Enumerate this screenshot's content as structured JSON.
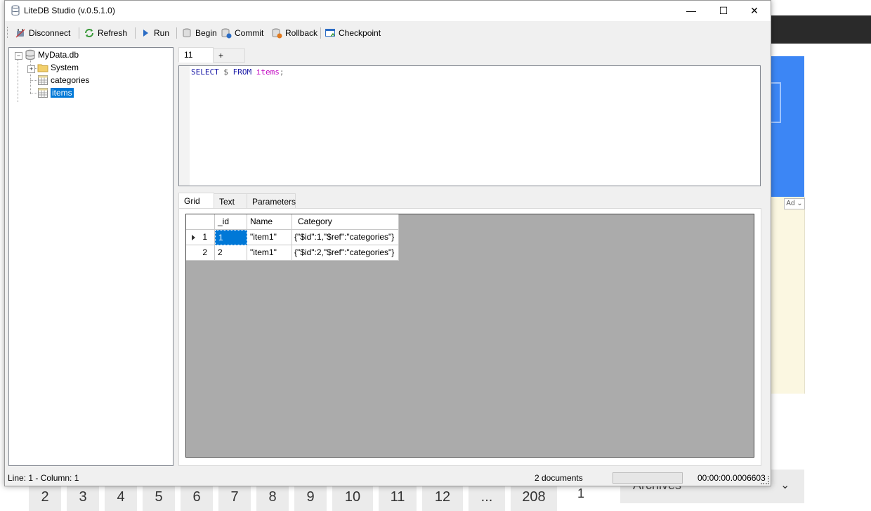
{
  "window": {
    "title": "LiteDB Studio (v.0.5.1.0)",
    "minimize_glyph": "—",
    "maximize_glyph": "☐",
    "close_glyph": "✕"
  },
  "toolbar": {
    "disconnect": "Disconnect",
    "refresh": "Refresh",
    "run": "Run",
    "begin": "Begin",
    "commit": "Commit",
    "rollback": "Rollback",
    "checkpoint": "Checkpoint"
  },
  "tree": {
    "root": "MyData.db",
    "system": "System",
    "collections": [
      "categories",
      "items"
    ],
    "selected": "items"
  },
  "query_tabs": [
    "11",
    "+"
  ],
  "editor": {
    "tokens": {
      "select": "SELECT",
      "star": "$",
      "from": "FROM",
      "table": "items",
      "semi": ";"
    }
  },
  "result_tabs": [
    "Grid",
    "Text",
    "Parameters"
  ],
  "grid": {
    "columns": [
      "_id",
      "Name",
      "Category"
    ],
    "rows": [
      {
        "index": "1",
        "cells": [
          "1",
          "\"item1\"",
          "{\"$id\":1,\"$ref\":\"categories\"}"
        ]
      },
      {
        "index": "2",
        "cells": [
          "2",
          "\"item1\"",
          "{\"$id\":2,\"$ref\":\"categories\"}"
        ]
      }
    ]
  },
  "status": {
    "position": "Line: 1 - Column: 1",
    "documents": "2 documents",
    "elapsed": "00:00:00.0006603"
  },
  "background": {
    "ad_label": "Ad",
    "archives": "Archives",
    "pagination": [
      "2",
      "3",
      "4",
      "5",
      "6",
      "7",
      "8",
      "9",
      "10",
      "11",
      "12",
      "...",
      "208",
      "1"
    ]
  },
  "colors": {
    "selection": "#0078d7",
    "grid_background": "#ababab",
    "keyword": "#1a1aa6",
    "table_name": "#c000c0"
  }
}
